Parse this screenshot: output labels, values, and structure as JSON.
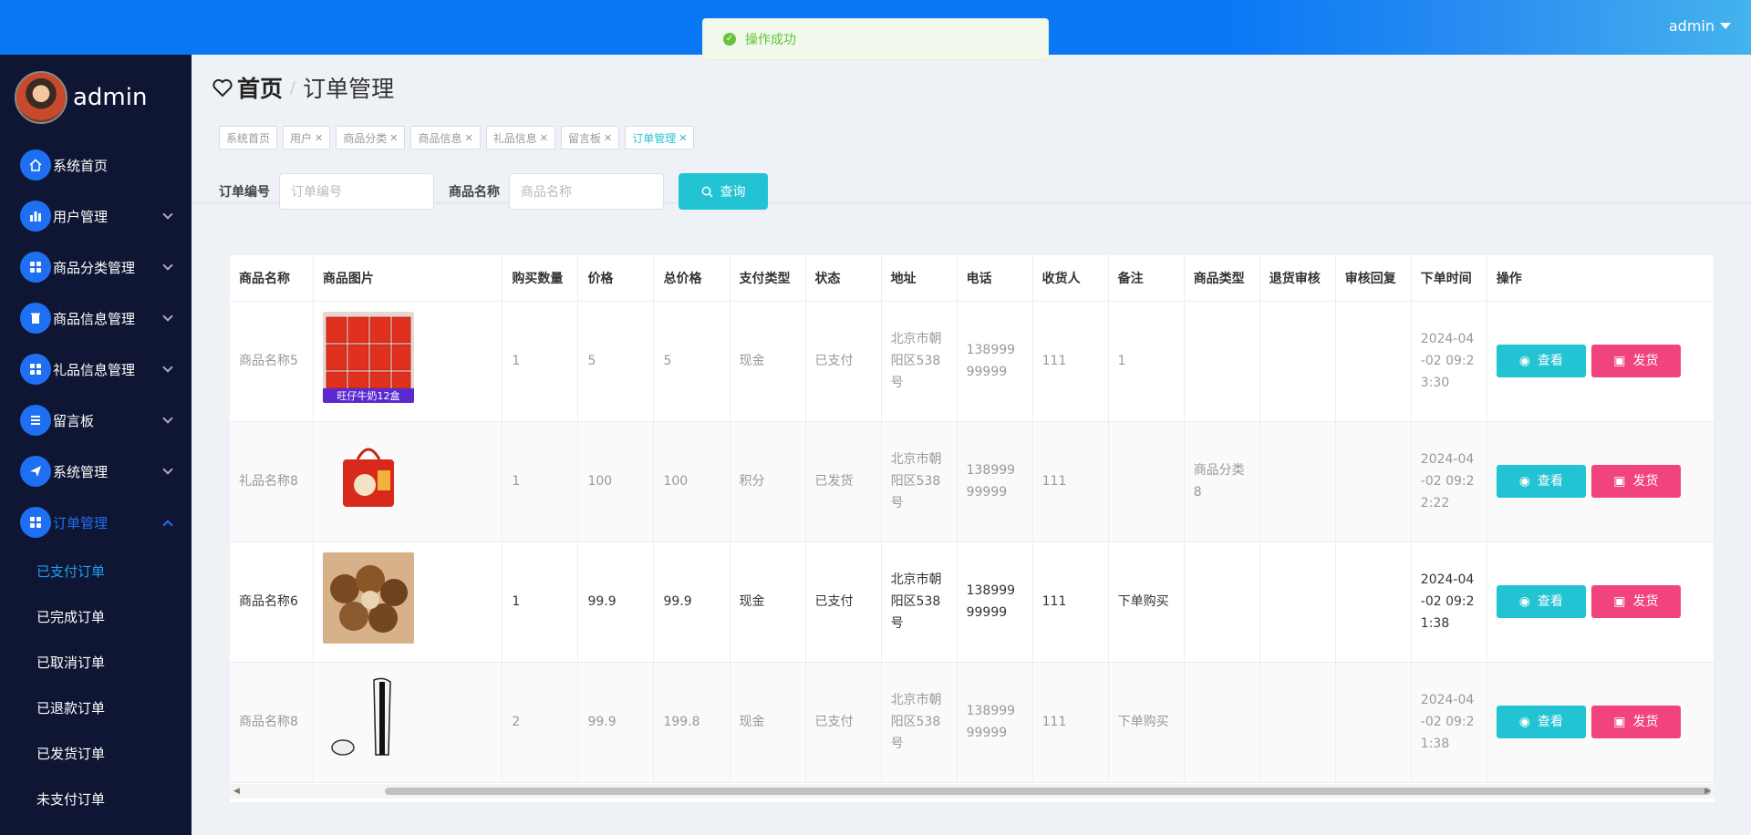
{
  "topbar": {
    "user": "admin"
  },
  "toast": {
    "text": "操作成功"
  },
  "sidebar": {
    "brand": "admin",
    "items": [
      {
        "label": "系统首页",
        "icon": "home-icon"
      },
      {
        "label": "用户管理",
        "icon": "chart-icon"
      },
      {
        "label": "商品分类管理",
        "icon": "grid-icon"
      },
      {
        "label": "商品信息管理",
        "icon": "trash-icon"
      },
      {
        "label": "礼品信息管理",
        "icon": "grid-icon"
      },
      {
        "label": "留言板",
        "icon": "list-icon"
      },
      {
        "label": "系统管理",
        "icon": "send-icon"
      },
      {
        "label": "订单管理",
        "icon": "grid-icon"
      }
    ],
    "submenu": [
      "已支付订单",
      "已完成订单",
      "已取消订单",
      "已退款订单",
      "已发货订单",
      "未支付订单"
    ]
  },
  "breadcrumb": {
    "home": "首页",
    "sep": "/",
    "current": "订单管理"
  },
  "tags": [
    {
      "label": "系统首页",
      "closable": false
    },
    {
      "label": "用户",
      "closable": true
    },
    {
      "label": "商品分类",
      "closable": true
    },
    {
      "label": "商品信息",
      "closable": true
    },
    {
      "label": "礼品信息",
      "closable": true
    },
    {
      "label": "留言板",
      "closable": true
    },
    {
      "label": "订单管理",
      "closable": true
    }
  ],
  "search": {
    "order_label": "订单编号",
    "order_placeholder": "订单编号",
    "name_label": "商品名称",
    "name_placeholder": "商品名称",
    "button": "查询"
  },
  "table": {
    "headers": [
      "商品名称",
      "商品图片",
      "购买数量",
      "价格",
      "总价格",
      "支付类型",
      "状态",
      "地址",
      "电话",
      "收货人",
      "备注",
      "商品类型",
      "退货审核",
      "审核回复",
      "下单时间",
      "操作"
    ],
    "view_label": "查看",
    "ship_label": "发货",
    "rows": [
      {
        "name": "商品名称5",
        "image": "milk-box",
        "qty": "1",
        "price": "5",
        "total": "5",
        "pay": "现金",
        "status": "已支付",
        "addr": "北京市朝阳区538号",
        "phone": "13899999999",
        "receiver": "111",
        "note": "1",
        "type": "",
        "refund": "",
        "reply": "",
        "time": "2024-04-02 09:23:30",
        "img_text": "旺仔牛奶12盒"
      },
      {
        "name": "礼品名称8",
        "image": "gift-bag",
        "qty": "1",
        "price": "100",
        "total": "100",
        "pay": "积分",
        "status": "已发货",
        "addr": "北京市朝阳区538号",
        "phone": "13899999999",
        "receiver": "111",
        "note": "",
        "type": "商品分类8",
        "refund": "",
        "reply": "",
        "time": "2024-04-02 09:22:22",
        "img_text": ""
      },
      {
        "name": "商品名称6",
        "image": "nuts",
        "qty": "1",
        "price": "99.9",
        "total": "99.9",
        "pay": "现金",
        "status": "已支付",
        "addr": "北京市朝阳区538号",
        "phone": "13899999999",
        "receiver": "111",
        "note": "下单购买",
        "type": "",
        "refund": "",
        "reply": "",
        "time": "2024-04-02 09:21:38",
        "img_text": ""
      },
      {
        "name": "商品名称8",
        "image": "game-console",
        "qty": "2",
        "price": "99.9",
        "total": "199.8",
        "pay": "现金",
        "status": "已支付",
        "addr": "北京市朝阳区538号",
        "phone": "13899999999",
        "receiver": "111",
        "note": "下单购买",
        "type": "",
        "refund": "",
        "reply": "",
        "time": "2024-04-02 09:21:38",
        "img_text": ""
      }
    ]
  }
}
